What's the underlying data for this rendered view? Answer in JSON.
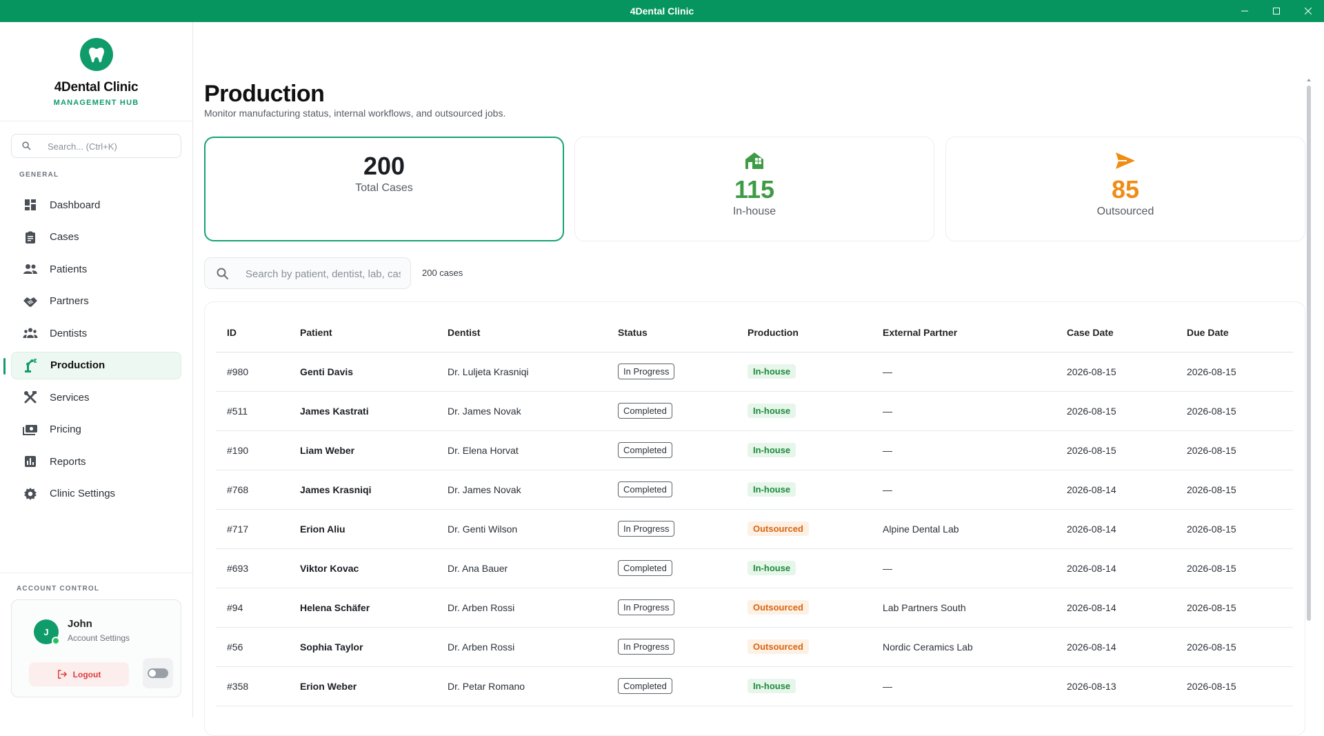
{
  "window": {
    "title": "4Dental Clinic"
  },
  "brand": {
    "name": "4Dental Clinic",
    "subtitle": "MANAGEMENT HUB"
  },
  "sidebar": {
    "search_placeholder": "Search... (Ctrl+K)",
    "section_general": "GENERAL",
    "items": [
      {
        "label": "Dashboard",
        "icon": "dashboard-icon"
      },
      {
        "label": "Cases",
        "icon": "clipboard-icon"
      },
      {
        "label": "Patients",
        "icon": "people-icon"
      },
      {
        "label": "Partners",
        "icon": "handshake-icon"
      },
      {
        "label": "Dentists",
        "icon": "group-icon"
      },
      {
        "label": "Production",
        "icon": "precision-manufacturing-icon"
      },
      {
        "label": "Services",
        "icon": "tools-icon"
      },
      {
        "label": "Pricing",
        "icon": "payments-icon"
      },
      {
        "label": "Reports",
        "icon": "bar-chart-icon"
      },
      {
        "label": "Clinic Settings",
        "icon": "gear-icon"
      }
    ],
    "active_index": 5,
    "section_account": "ACCOUNT CONTROL",
    "account": {
      "initial": "J",
      "name": "John",
      "sub": "Account Settings",
      "logout": "Logout"
    }
  },
  "page": {
    "title": "Production",
    "subtitle": "Monitor manufacturing status, internal workflows, and outsourced jobs."
  },
  "stats": {
    "total": {
      "value": "200",
      "label": "Total Cases"
    },
    "inhouse": {
      "value": "115",
      "label": "In-house",
      "color": "#3d9b45",
      "icon": "house-icon"
    },
    "outsourced": {
      "value": "85",
      "label": "Outsourced",
      "color": "#f08c14",
      "icon": "send-icon"
    }
  },
  "search": {
    "placeholder": "Search by patient, dentist, lab, case...",
    "count": "200 cases"
  },
  "table": {
    "headers": [
      "ID",
      "Patient",
      "Dentist",
      "Status",
      "Production",
      "External Partner",
      "Case Date",
      "Due Date"
    ],
    "rows": [
      {
        "id": "#980",
        "patient": "Genti Davis",
        "dentist": "Dr. Luljeta Krasniqi",
        "status": "In Progress",
        "production": "In-house",
        "partner": "—",
        "case_date": "2026-08-15",
        "due_date": "2026-08-15"
      },
      {
        "id": "#511",
        "patient": "James Kastrati",
        "dentist": "Dr. James Novak",
        "status": "Completed",
        "production": "In-house",
        "partner": "—",
        "case_date": "2026-08-15",
        "due_date": "2026-08-15"
      },
      {
        "id": "#190",
        "patient": "Liam Weber",
        "dentist": "Dr. Elena Horvat",
        "status": "Completed",
        "production": "In-house",
        "partner": "—",
        "case_date": "2026-08-15",
        "due_date": "2026-08-15"
      },
      {
        "id": "#768",
        "patient": "James Krasniqi",
        "dentist": "Dr. James Novak",
        "status": "Completed",
        "production": "In-house",
        "partner": "—",
        "case_date": "2026-08-14",
        "due_date": "2026-08-15"
      },
      {
        "id": "#717",
        "patient": "Erion Aliu",
        "dentist": "Dr. Genti Wilson",
        "status": "In Progress",
        "production": "Outsourced",
        "partner": "Alpine Dental Lab",
        "case_date": "2026-08-14",
        "due_date": "2026-08-15"
      },
      {
        "id": "#693",
        "patient": "Viktor Kovac",
        "dentist": "Dr. Ana Bauer",
        "status": "Completed",
        "production": "In-house",
        "partner": "—",
        "case_date": "2026-08-14",
        "due_date": "2026-08-15"
      },
      {
        "id": "#94",
        "patient": "Helena Schäfer",
        "dentist": "Dr. Arben Rossi",
        "status": "In Progress",
        "production": "Outsourced",
        "partner": "Lab Partners South",
        "case_date": "2026-08-14",
        "due_date": "2026-08-15"
      },
      {
        "id": "#56",
        "patient": "Sophia Taylor",
        "dentist": "Dr. Arben Rossi",
        "status": "In Progress",
        "production": "Outsourced",
        "partner": "Nordic Ceramics Lab",
        "case_date": "2026-08-14",
        "due_date": "2026-08-15"
      },
      {
        "id": "#358",
        "patient": "Erion Weber",
        "dentist": "Dr. Petar Romano",
        "status": "Completed",
        "production": "In-house",
        "partner": "—",
        "case_date": "2026-08-13",
        "due_date": "2026-08-15"
      }
    ]
  },
  "colors": {
    "brand": "#06955f",
    "accent": "#0f9b6a",
    "inhouse": "#3d9b45",
    "outsourced": "#f08c14"
  }
}
